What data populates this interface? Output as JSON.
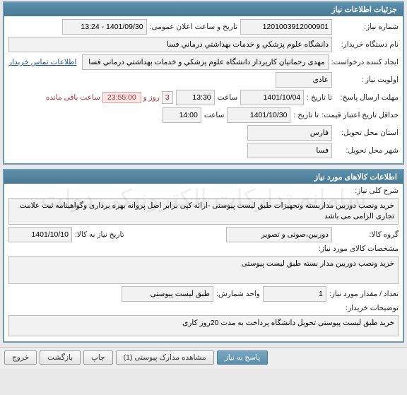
{
  "watermark": "سامانه تدارکات الکترونیکی دولت",
  "panel1": {
    "title": "جزئیات اطلاعات نیاز",
    "need_no_label": "شماره نیاز:",
    "need_no": "1201003912000901",
    "public_datetime_label": "تاریخ و ساعت اعلان عمومی:",
    "public_datetime": "1401/09/30 - 13:24",
    "buyer_label": "نام دستگاه خریدار:",
    "buyer": "دانشگاه علوم پزشکي و خدمات بهداشتي درماني فسا",
    "creator_label": "ایجاد کننده درخواست:",
    "creator": "مهدی رحمانیان کارپرداز دانشگاه علوم پزشکي و خدمات بهداشتي درماني فسا",
    "contact_link": "اطلاعات تماس خریدار",
    "priority_label": "اولویت نیاز :",
    "priority": "عادی",
    "deadline_label": "مهلت ارسال پاسخ:",
    "to_date_label": "تا تاریخ :",
    "deadline_date": "1401/10/04",
    "time_label": "ساعت",
    "deadline_time": "13:30",
    "remaining_days": "3",
    "remaining_days_label": "روز و",
    "remaining_time": "23:55:00",
    "remaining_suffix": "ساعت باقی مانده",
    "quote_valid_label": "حداقل تاریخ اعتبار قیمت:",
    "quote_valid_date": "1401/10/30",
    "quote_valid_time": "14:00",
    "delivery_province_label": "استان محل تحویل:",
    "delivery_province": "فارس",
    "delivery_city_label": "شهر محل تحویل:",
    "delivery_city": "فسا"
  },
  "panel2": {
    "title": "اطلاعات کالاهای مورد نیاز",
    "desc_label": "شرح کلی نیاز:",
    "desc": "خرید ونصب دوربین مداربسته وتجهیزات طبق لیست پیوستی -ارائه کپی برابر اصل پروانه بهره برداری وگواهینامه ثبت علامت تجاری الزامی می باشد",
    "group_label": "گروه کالا:",
    "group": "دوربین،صوتی و تصویر",
    "need_date_label": "تاریخ نیاز به کالا:",
    "need_date": "1401/10/10",
    "spec_label": "مشخصات کالای مورد نیاز:",
    "spec": "خرید ونصب دوربین مدار بسته طبق لیست پیوستی",
    "qty_label": "تعداد / مقدار مورد نیاز:",
    "qty": "1",
    "unit_label": "واحد شمارش:",
    "unit": "طبق لیست پیوستی",
    "buyer_note_label": "توضیحات خریدار:",
    "buyer_note": "خرید طبق لیست پیوستی تحویل دانشگاه پرداخت به مدت 20روز کاری"
  },
  "footer": {
    "reply": "پاسخ به نیاز",
    "attachments": "مشاهده مدارک پیوستی (1)",
    "print": "چاپ",
    "back": "بازگشت",
    "exit": "خروج"
  }
}
